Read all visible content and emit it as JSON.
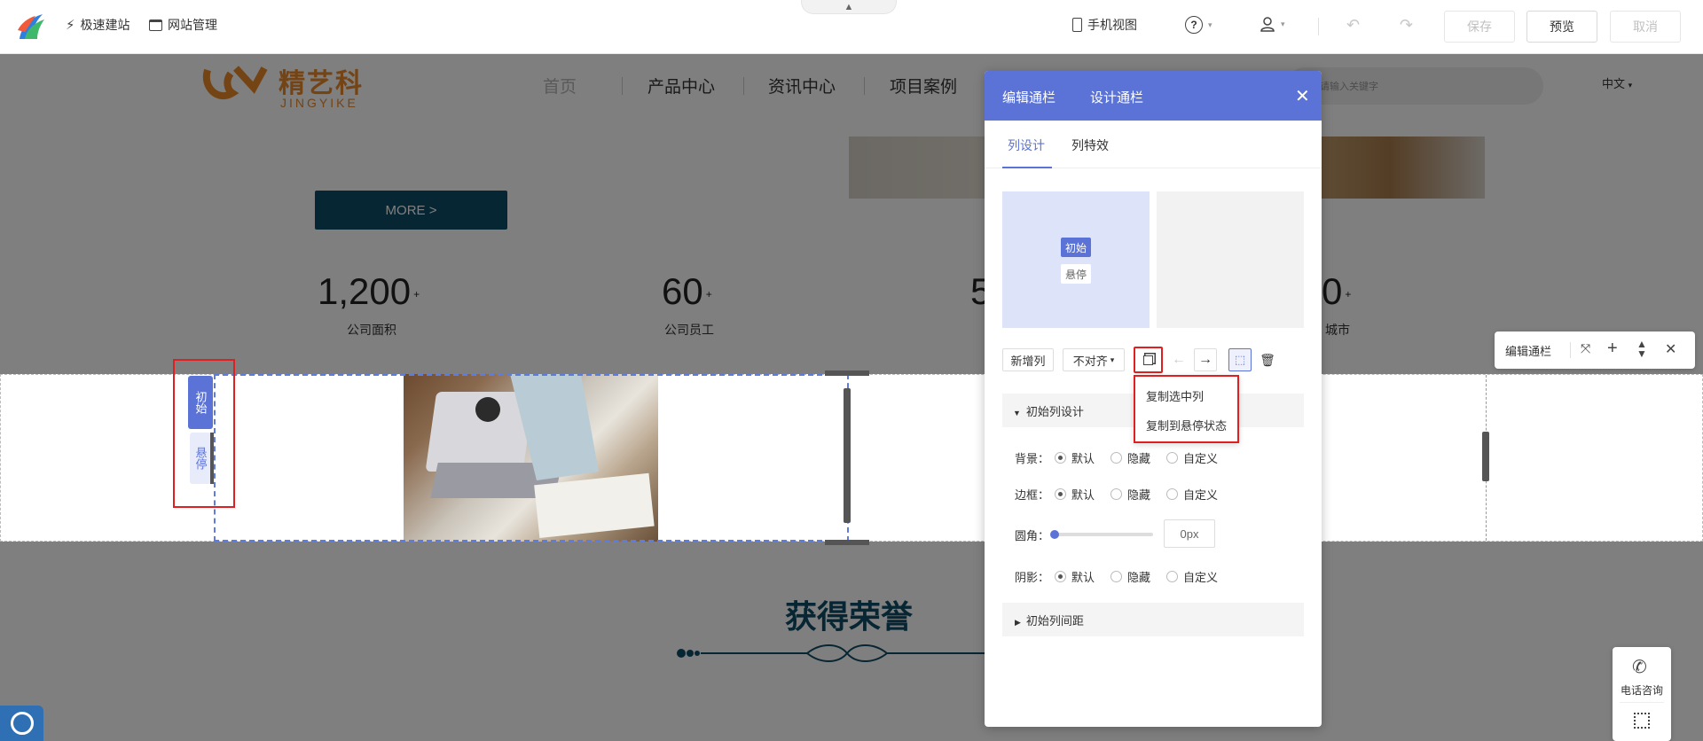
{
  "topbar": {
    "quick_build": "极速建站",
    "site_manage": "网站管理",
    "mobile_view": "手机视图",
    "save": "保存",
    "preview": "预览",
    "cancel": "取消"
  },
  "site": {
    "logo_cn": "精艺科",
    "logo_en": "JINGYIKE",
    "nav": [
      "首页",
      "产品中心",
      "资讯中心",
      "项目案例"
    ],
    "search_placeholder": "请输入关键字",
    "lang": "中文",
    "more_button": "MORE >",
    "stats": [
      {
        "value": "1,200",
        "suffix": "+",
        "label": "公司面积"
      },
      {
        "value": "60",
        "suffix": "+",
        "label": "公司员工"
      },
      {
        "value": "5",
        "suffix": "",
        "label": ""
      },
      {
        "value": "0",
        "suffix": "+",
        "label": "城市"
      }
    ],
    "honor_title": "获得荣誉"
  },
  "state_tag": {
    "initial": "初始",
    "hover": "悬停"
  },
  "panel": {
    "tab_edit": "编辑通栏",
    "tab_design": "设计通栏",
    "subtab_col_design": "列设计",
    "subtab_col_effect": "列特效",
    "preview_initial": "初始",
    "preview_hover": "悬停",
    "add_col": "新增列",
    "align": "不对齐",
    "dropdown": [
      "复制选中列",
      "复制到悬停状态"
    ],
    "section_col_design": "初始列设计",
    "bg_label": "背景：",
    "border_label": "边框：",
    "radius_label": "圆角：",
    "shadow_label": "阴影：",
    "opt_default": "默认",
    "opt_hide": "隐藏",
    "opt_custom": "自定义",
    "radius_value": "0px",
    "section_col_spacing": "初始列间距"
  },
  "row_toolbar": {
    "label": "编辑通栏"
  },
  "consult": {
    "label": "电话咨询"
  }
}
